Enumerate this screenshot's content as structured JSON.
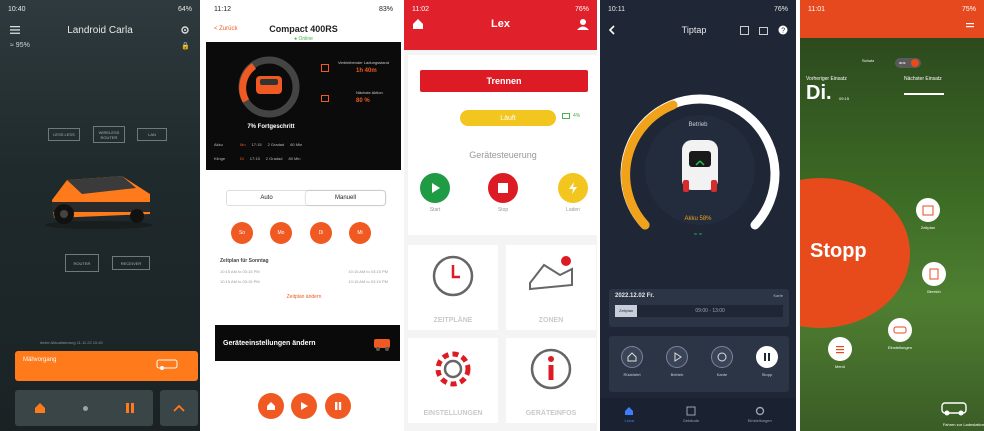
{
  "p1": {
    "status_time": "10:40",
    "status_right": "64%",
    "title": "Landroid Carla",
    "wifi_label": "95%",
    "nodes": [
      "LESS LESS",
      "WIRELESS ROUTER",
      "LAN",
      "ROUTER",
      "RECEIVER"
    ],
    "footnote": "letzte Aktualisierung 11.11.22 10:40",
    "status_card": "Mähvorgang",
    "icons": [
      "home-icon",
      "pause-icon",
      "chevron-up-icon"
    ]
  },
  "p2": {
    "status_time": "11:12",
    "status_right": "83%",
    "back": "< Zurück",
    "title": "Compact 400RS",
    "online": "Online",
    "progress_label": "7% Fortgeschritt",
    "right_labels": [
      "Verbleibender Ladungsstand",
      "Nächste Aktion"
    ],
    "right_values": [
      "1h 40m",
      "80 %"
    ],
    "row_labels": [
      "Akku",
      "Klinge"
    ],
    "row_vals": [
      "Mo",
      "17:15",
      "2 Gradad",
      "80 Min",
      "Di",
      "17:15",
      "2 Gradad",
      "80 Min"
    ],
    "tabs": [
      "Auto",
      "Manuell"
    ],
    "days": [
      "So",
      "Mo",
      "Di",
      "Mi"
    ],
    "schedule_title": "Zeitplan für Sonntag",
    "schedule_rows": [
      "10:15 AM to 03:15 PM",
      "10:15 AM to 03:15 PM",
      "10:15 AM to 03:15 PM",
      "10:15 AM to 03:15 PM"
    ],
    "schedule_link": "Zeitplan ändern",
    "banner": "Geräteeinstellungen ändern"
  },
  "p3": {
    "status_time": "11:02",
    "status_right": "76%",
    "title": "Lex",
    "trennen": "Trennen",
    "lauft": "Läuft",
    "battery": "4%",
    "section": "Gerätesteuerung",
    "controls": [
      "Start",
      "Stop",
      "Laden"
    ],
    "tiles": [
      "ZEITPLÄNE",
      "ZONEN",
      "EINSTELLUNGEN",
      "GERÄTEINFOS"
    ]
  },
  "p4": {
    "status_time": "10:11",
    "status_right": "76%",
    "title": "Tiptap",
    "status_word": "Betrieb",
    "battery_text": "Akku 58%",
    "date": "2022.12.02 Fr.",
    "date_right": "Karte",
    "chip": "Zeitplan",
    "time_range": "09:00 - 13:00",
    "controls": [
      "Rückfahrt",
      "Betrieb",
      "Kante",
      "Stopp"
    ],
    "tabs": [
      "Leica",
      "Gebäude",
      "Einstellungen"
    ]
  },
  "p5": {
    "status_time": "11:01",
    "status_right": "75%",
    "toggle_label": "Schutz",
    "toggle_state": "aus",
    "left_label": "Vorheriger Einsatz",
    "day": "Di.",
    "day_time": "09:15",
    "right_label": "Nächster Einsatz",
    "stopp": "Stopp",
    "buttons": [
      "Zeitplan",
      "Bereich",
      "Einstellungen",
      "Menü"
    ],
    "dock_label": "Fahren zur Ladestation"
  },
  "colors": {
    "worx_orange": "#ff7a1a",
    "husq_orange": "#f05a22",
    "lex_red": "#e0202a",
    "tiptap_bg": "#1f2736",
    "stopp_orange": "#e74b1c"
  }
}
